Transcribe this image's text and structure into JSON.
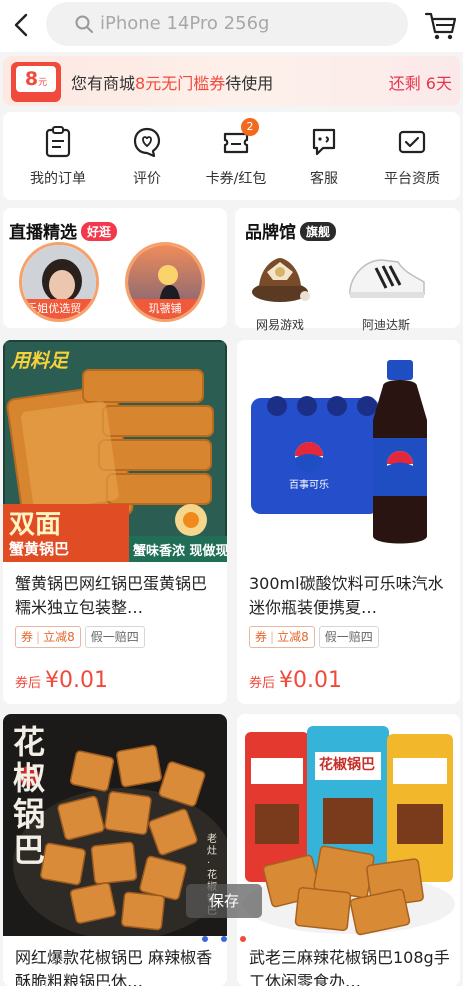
{
  "search": {
    "placeholder": "iPhone 14Pro 256g"
  },
  "coupon": {
    "amount": "8",
    "unit": "元",
    "msg_before": "您有商城",
    "msg_highlight": "8元无门槛券",
    "msg_after": "待使用",
    "remaining": "还剩 6天"
  },
  "services": [
    {
      "label": "我的订单",
      "icon": "order-icon"
    },
    {
      "label": "评价",
      "icon": "review-icon"
    },
    {
      "label": "卡券/红包",
      "icon": "coupon-icon",
      "badge": "2"
    },
    {
      "label": "客服",
      "icon": "service-icon"
    },
    {
      "label": "平台资质",
      "icon": "certificate-icon"
    }
  ],
  "live": {
    "title": "直播精选",
    "tag": "好逛",
    "streamers": [
      "乐姐优选贸...",
      "玑虢铺"
    ]
  },
  "brand": {
    "title": "品牌馆",
    "tag": "旗舰",
    "items": [
      "网易游戏",
      "阿迪达斯"
    ]
  },
  "products": [
    {
      "title": "蟹黄锅巴网红锅巴蛋黄锅巴糯米独立包装整…",
      "coupon_label": "券",
      "coupon_value": "立减8",
      "guarantee": "假一赔四",
      "price_prefix": "券后",
      "price": "¥0.01",
      "img_text": {
        "top": "用料足",
        "big": "双面",
        "sub": "蟹黄锅巴",
        "bar": "蟹味香浓 现做现发"
      }
    },
    {
      "title": "300ml碳酸饮料可乐味汽水迷你瓶装便携夏…",
      "coupon_label": "券",
      "coupon_value": "立减8",
      "guarantee": "假一赔四",
      "price_prefix": "券后",
      "price": "¥0.01",
      "img_text": {
        "label": "百事可乐"
      }
    },
    {
      "title": "网红爆款花椒锅巴 麻辣椒香酥脆粗粮锅巴休…",
      "img_text": {
        "big": "花椒锅巴",
        "side": "老灶·花椒锅巴"
      }
    },
    {
      "title": "武老三麻辣花椒锅巴108g手工休闲零食办…",
      "img_text": {
        "bag": "花椒锅巴"
      }
    }
  ],
  "toast": "保存",
  "colors": {
    "accent": "#f04a3c",
    "badge": "#f26a1d",
    "dot_active": "#f04a3c",
    "dot_inactive": "#3b6ad6"
  }
}
